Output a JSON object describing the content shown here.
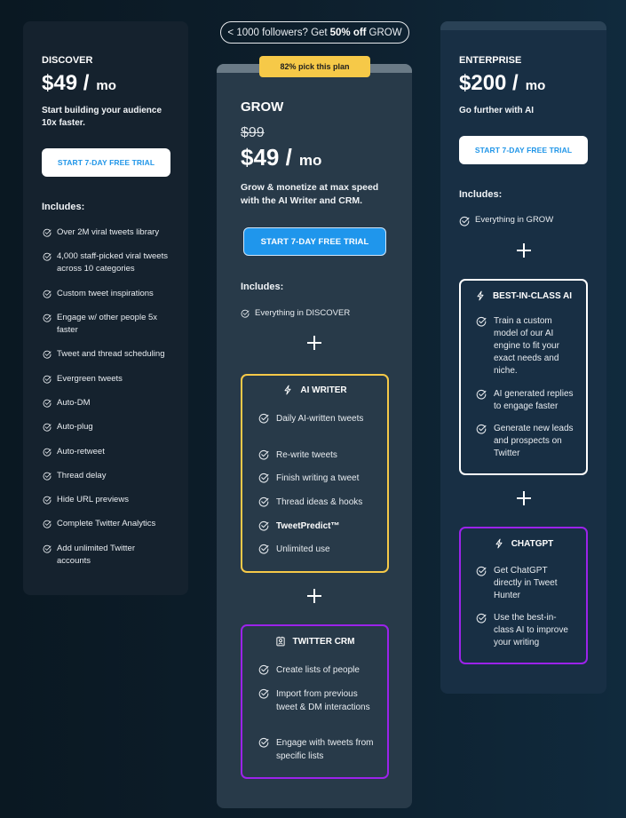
{
  "promo": {
    "prefix": "< 1000 followers? Get",
    "highlight": "50% off",
    "suffix": "GROW"
  },
  "plans": {
    "discover": {
      "name": "DISCOVER",
      "price": "$49 /",
      "period": "mo",
      "description": "Start building your audience 10x faster.",
      "cta": "START 7-DAY FREE TRIAL",
      "includes_label": "Includes:",
      "features": [
        "Over 2M viral tweets library",
        "4,000 staff-picked viral tweets across 10 categories",
        "Custom tweet inspirations",
        "Engage w/ other people 5x faster",
        "Tweet and thread scheduling",
        "Evergreen tweets",
        "Auto-DM",
        "Auto-plug",
        "Auto-retweet",
        "Thread delay",
        "Hide URL previews",
        "Complete Twitter Analytics",
        "Add unlimited Twitter accounts"
      ]
    },
    "grow": {
      "badge": "82% pick this plan",
      "name": "GROW",
      "old_price": "$99",
      "price": "$49 /",
      "period": "mo",
      "description": "Grow & monetize at max speed with the AI Writer and CRM.",
      "cta": "START 7-DAY FREE TRIAL",
      "includes_label": "Includes:",
      "base_feature": "Everything in DISCOVER",
      "ai_writer": {
        "title": "AI WRITER",
        "icon": "lightning-icon",
        "features": [
          "Daily AI-written tweets",
          "Re-write tweets",
          "Finish writing a tweet",
          "Thread ideas & hooks",
          "TweetPredict™",
          "Unlimited use"
        ]
      },
      "crm": {
        "title": "TWITTER CRM",
        "icon": "contact-card-icon",
        "features": [
          "Create lists of people",
          "Import from previous tweet & DM interactions",
          "Engage with tweets from specific lists"
        ]
      }
    },
    "enterprise": {
      "name": "ENTERPRISE",
      "price": "$200 /",
      "period": "mo",
      "description": "Go further with AI",
      "cta": "START 7-DAY FREE TRIAL",
      "includes_label": "Includes:",
      "base_feature": "Everything in GROW",
      "best_ai": {
        "title": "BEST-IN-CLASS AI",
        "icon": "lightning-icon",
        "features": [
          "Train a custom model of our AI engine to fit your exact needs and niche.",
          "AI generated replies to engage faster",
          "Generate new leads and prospects on Twitter"
        ]
      },
      "chatgpt": {
        "title": "CHATGPT",
        "icon": "lightning-icon",
        "features": [
          "Get ChatGPT directly in Tweet Hunter",
          "Use the best-in-class AI to improve your writing"
        ]
      }
    }
  },
  "colors": {
    "accent_blue": "#1f96ec",
    "badge_yellow": "#f6c948",
    "crm_purple": "#9b23ea"
  }
}
